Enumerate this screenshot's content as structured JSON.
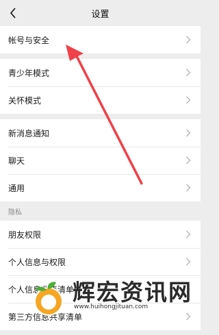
{
  "header": {
    "title": "设置"
  },
  "groups": [
    {
      "items": [
        {
          "label": "帐号与安全"
        }
      ]
    },
    {
      "items": [
        {
          "label": "青少年模式"
        },
        {
          "label": "关怀模式"
        }
      ]
    },
    {
      "items": [
        {
          "label": "新消息通知"
        },
        {
          "label": "聊天"
        },
        {
          "label": "通用"
        }
      ]
    },
    {
      "header": "隐私",
      "items": [
        {
          "label": "朋友权限"
        },
        {
          "label": "个人信息与权限"
        },
        {
          "label": "个人信息收集清单"
        },
        {
          "label": "第三方信息共享清单"
        }
      ]
    }
  ],
  "annotation": {
    "color": "#f0414a"
  },
  "watermark": {
    "text": "辉宏资讯网",
    "url": "www.huihongjituan.com"
  },
  "colors": {
    "background": "#ededed",
    "text": "#1a1a1a",
    "chevron": "#b2b2b2"
  }
}
